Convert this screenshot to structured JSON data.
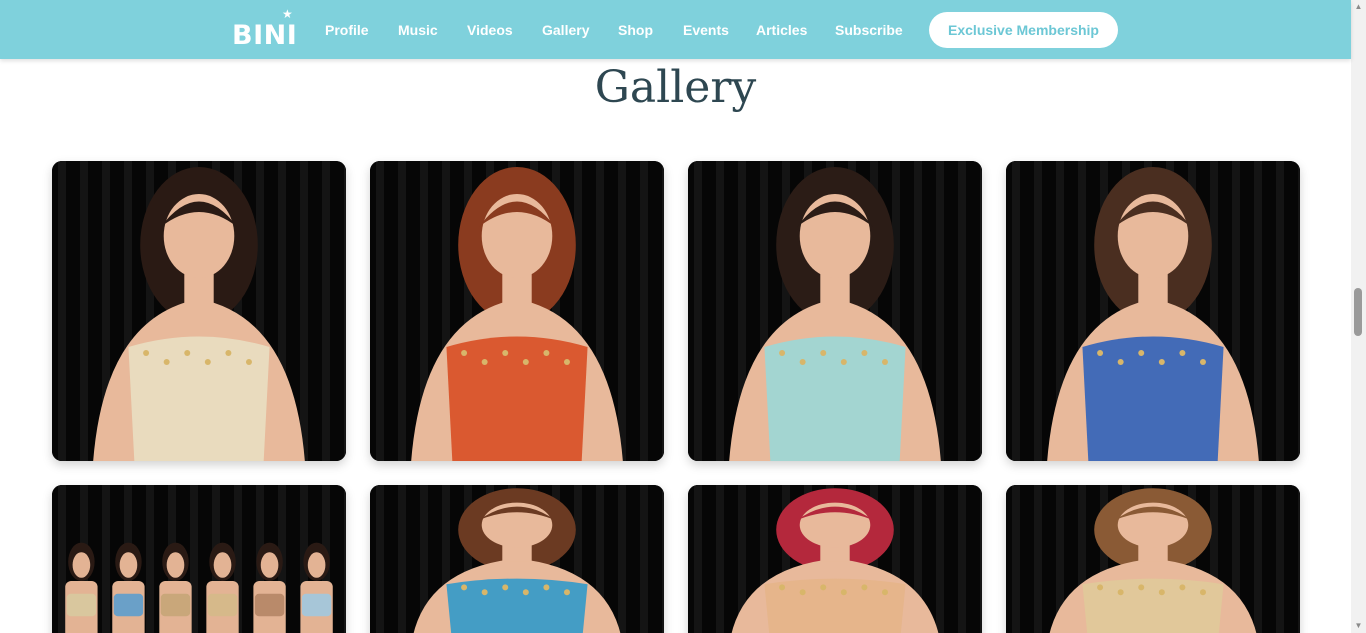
{
  "brand": {
    "logo_text": "BINI",
    "logo_star": "★",
    "accent": "#7fd1dc",
    "title_color": "#2e4751"
  },
  "nav": {
    "links": [
      "Profile",
      "Music",
      "Videos",
      "Gallery",
      "Shop",
      "Events",
      "Articles",
      "Subscribe"
    ],
    "cta": "Exclusive Membership"
  },
  "page": {
    "title": "Gallery"
  },
  "gallery": {
    "items": [
      {
        "subject": "solo-portrait",
        "hair": "#2a1a14",
        "outfit": "#e9dcc0"
      },
      {
        "subject": "solo-portrait",
        "hair": "#8a3b1f",
        "outfit": "#d9532a"
      },
      {
        "subject": "solo-portrait",
        "hair": "#2b1c16",
        "outfit": "#9fd6d4"
      },
      {
        "subject": "solo-portrait",
        "hair": "#4a2e20",
        "outfit": "#3a66b8"
      },
      {
        "subject": "group-photo",
        "hair": "#2a1a14",
        "outfit": "#c9a77a"
      },
      {
        "subject": "solo-portrait",
        "hair": "#6b3a22",
        "outfit": "#3b9bc7"
      },
      {
        "subject": "solo-portrait",
        "hair": "#b4283c",
        "outfit": "#e6b48a"
      },
      {
        "subject": "solo-portrait",
        "hair": "#8a5a35",
        "outfit": "#e0c89a"
      }
    ]
  }
}
